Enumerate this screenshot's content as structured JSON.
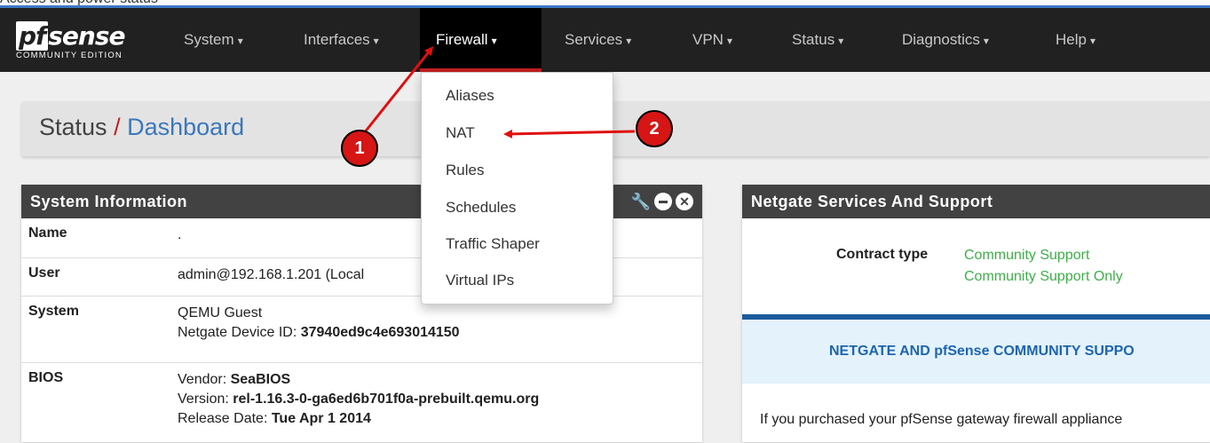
{
  "top_strip_text": "Access and power status",
  "nav": {
    "logo": "pfsense",
    "edition": "COMMUNITY EDITION",
    "items": [
      {
        "label": "System"
      },
      {
        "label": "Interfaces"
      },
      {
        "label": "Firewall"
      },
      {
        "label": "Services"
      },
      {
        "label": "VPN"
      },
      {
        "label": "Status"
      },
      {
        "label": "Diagnostics"
      },
      {
        "label": "Help"
      }
    ],
    "caret": "▾"
  },
  "breadcrumb": {
    "section": "Status",
    "separator": "/",
    "page": "Dashboard"
  },
  "dropdown": {
    "items": [
      {
        "label": "Aliases"
      },
      {
        "label": "NAT"
      },
      {
        "label": "Rules"
      },
      {
        "label": "Schedules"
      },
      {
        "label": "Traffic Shaper"
      },
      {
        "label": "Virtual IPs"
      }
    ]
  },
  "annotations": {
    "badge1": "1",
    "badge2": "2",
    "color": "#e01010"
  },
  "system_info": {
    "title": "System Information",
    "rows": {
      "name": {
        "key": "Name",
        "value": "."
      },
      "user": {
        "key": "User",
        "value": "admin@192.168.1.201 (Local"
      },
      "system": {
        "key": "System",
        "line1": "QEMU Guest",
        "line2_label": "Netgate Device ID: ",
        "line2_value": "37940ed9c4e693014150"
      },
      "bios": {
        "key": "BIOS",
        "vendor_label": "Vendor: ",
        "vendor": "SeaBIOS",
        "version_label": "Version: ",
        "version": "rel-1.16.3-0-ga6ed6b701f0a-prebuilt.qemu.org",
        "release_label": "Release Date: ",
        "release": "Tue Apr 1 2014"
      }
    }
  },
  "support": {
    "title": "Netgate Services And Support",
    "contract_label": "Contract type",
    "contract_value1": "Community Support",
    "contract_value2": "Community Support Only",
    "banner": "NETGATE AND pfSense COMMUNITY SUPPO",
    "text": "If you purchased your pfSense gateway firewall appliance"
  }
}
